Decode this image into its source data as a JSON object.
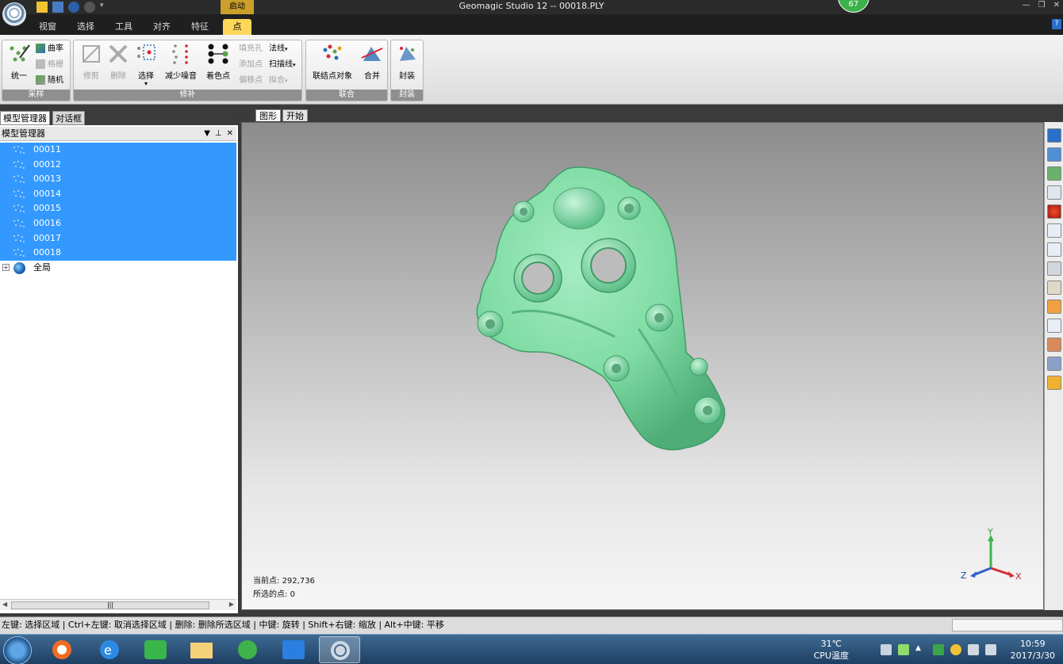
{
  "window": {
    "title": "Geomagic Studio 12 -- 00018.PLY",
    "context_tab": "启动",
    "badge": "67"
  },
  "ribbon_tabs": [
    "视窗",
    "选择",
    "工具",
    "对齐",
    "特征",
    "点"
  ],
  "ribbon": {
    "groups": {
      "sampling": {
        "label": "采样",
        "big": "统一",
        "small": [
          "曲率",
          "格栅",
          "随机"
        ]
      },
      "repair": {
        "label": "修补",
        "big": [
          "修剪",
          "删除",
          "选择",
          "减少噪音",
          "着色点"
        ],
        "small_col1": [
          "填充孔",
          "添加点",
          "偏移点"
        ],
        "small_col2": [
          "法线",
          "扫描线",
          "拟合"
        ]
      },
      "union": {
        "label": "联合",
        "big": [
          "联结点对象",
          "合并"
        ]
      },
      "wrap": {
        "label": "封装",
        "big": "封装"
      }
    }
  },
  "left_panel": {
    "tabs": [
      "模型管理器",
      "对话框"
    ],
    "header": "模型管理器",
    "items": [
      "00011",
      "00012",
      "00013",
      "00014",
      "00015",
      "00016",
      "00017",
      "00018"
    ],
    "global": "全局"
  },
  "viewport": {
    "tabs": [
      "图形",
      "开始"
    ],
    "current_points_label": "当前点:",
    "current_points": "292,736",
    "selected_points_label": "所选的点:",
    "selected_points": "0",
    "axis": {
      "x": "X",
      "y": "Y",
      "z": "Z"
    }
  },
  "statusbar": {
    "text": "左键: 选择区域 | Ctrl+左键: 取消选择区域 | 删除: 删除所选区域 | 中键: 旋转 | Shift+右键: 缩放 | Alt+中键: 平移"
  },
  "taskbar": {
    "temperature": "31℃",
    "temperature_label": "CPU温度",
    "time": "10:59",
    "date": "2017/3/30"
  }
}
